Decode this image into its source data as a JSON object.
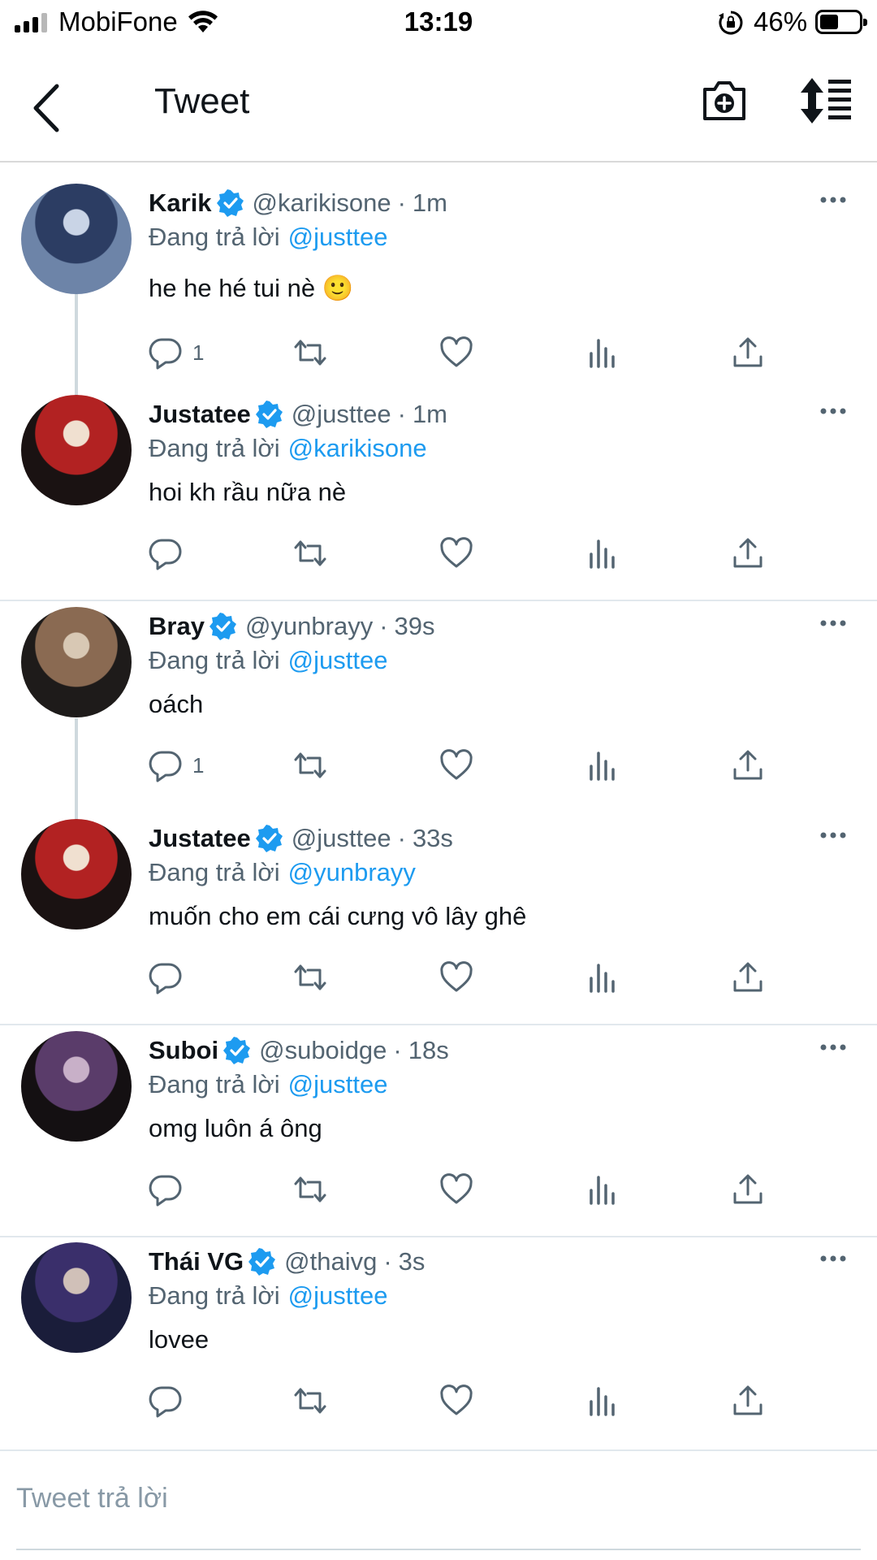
{
  "status_bar": {
    "carrier": "MobiFone",
    "time": "13:19",
    "battery_percent": "46%",
    "battery_level": 0.46
  },
  "header": {
    "title": "Tweet"
  },
  "colors": {
    "accent": "#1d9bf0",
    "text_primary": "#0f1419",
    "text_secondary": "#536471",
    "divider": "#e1e8ed"
  },
  "tweets": [
    {
      "name": "Karik",
      "handle": "@karikisone",
      "time": "1m",
      "reply_prefix": "Đang trả lời",
      "reply_to": "@justtee",
      "text": "he he hé tui nè 🙂",
      "reply_count": "1"
    },
    {
      "name": "Justatee",
      "handle": "@justtee",
      "time": "1m",
      "reply_prefix": "Đang trả lời",
      "reply_to": "@karikisone",
      "text": "hoi kh rầu nữa nè",
      "reply_count": ""
    },
    {
      "name": "Bray",
      "handle": "@yunbrayy",
      "time": "39s",
      "reply_prefix": "Đang trả lời",
      "reply_to": "@justtee",
      "text": "oách",
      "reply_count": "1"
    },
    {
      "name": "Justatee",
      "handle": "@justtee",
      "time": "33s",
      "reply_prefix": "Đang trả lời",
      "reply_to": "@yunbrayy",
      "text": "muốn cho em cái cưng vô lây ghê",
      "reply_count": ""
    },
    {
      "name": "Suboi",
      "handle": "@suboidge",
      "time": "18s",
      "reply_prefix": "Đang trả lời",
      "reply_to": "@justtee",
      "text": "omg luôn á ông",
      "reply_count": ""
    },
    {
      "name": "Thái VG",
      "handle": "@thaivg",
      "time": "3s",
      "reply_prefix": "Đang trả lời",
      "reply_to": "@justtee",
      "text": "lovee",
      "reply_count": ""
    }
  ],
  "compose": {
    "placeholder": "Tweet trả lời"
  }
}
